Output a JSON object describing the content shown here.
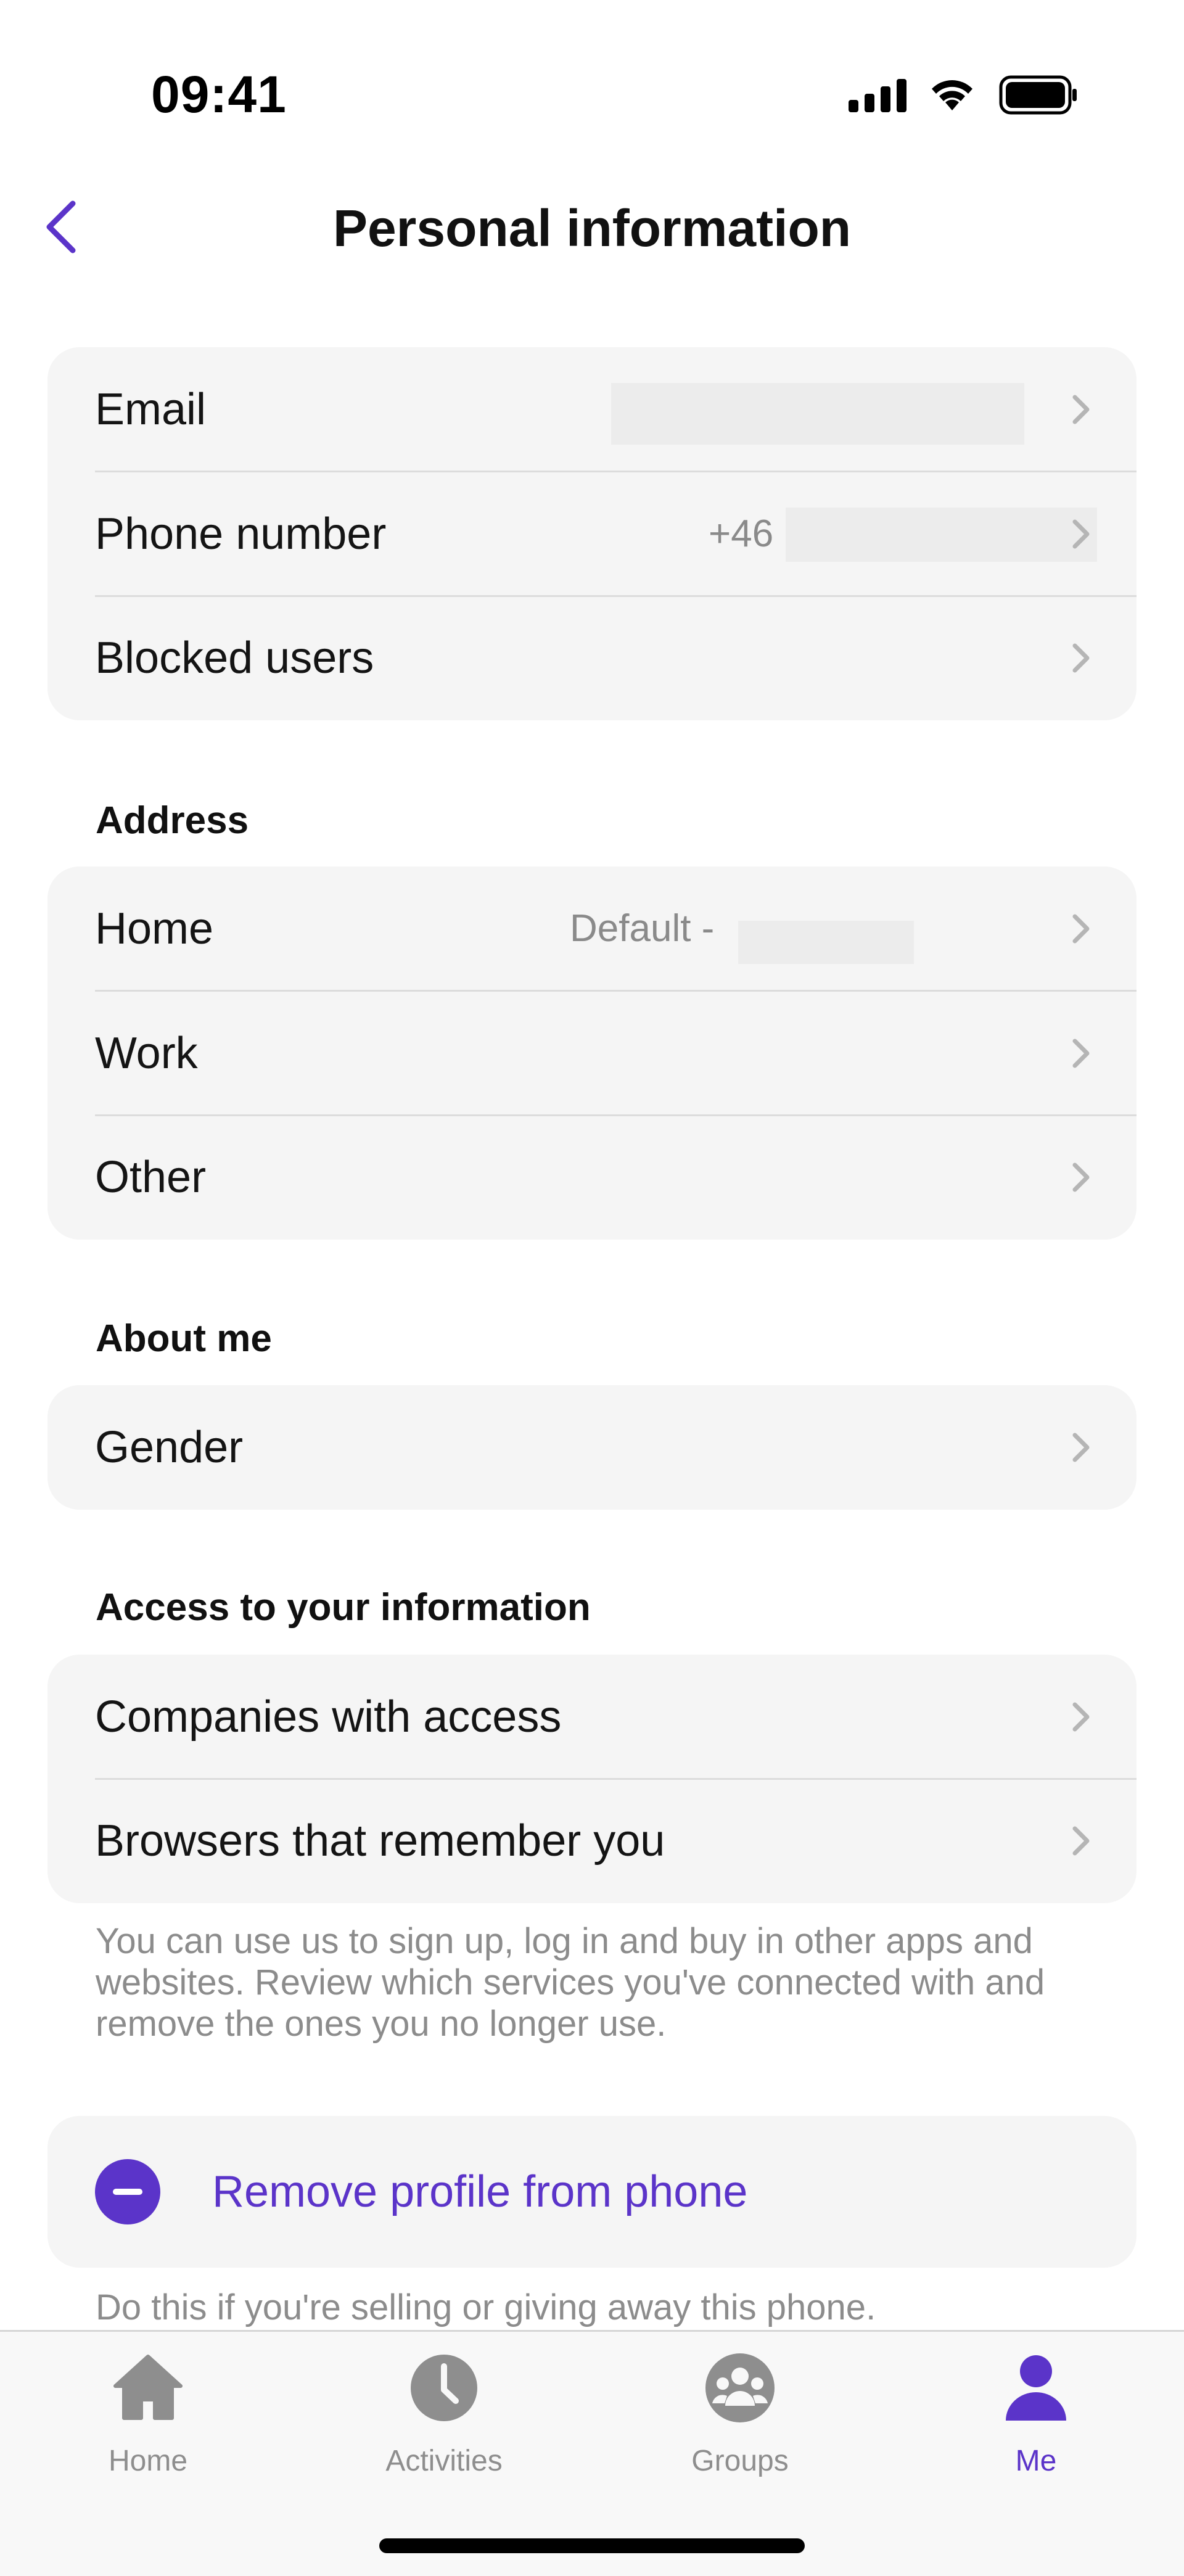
{
  "status_bar": {
    "time": "09:41"
  },
  "header": {
    "title": "Personal information"
  },
  "account": {
    "email_label": "Email",
    "phone_label": "Phone number",
    "phone_value": "+46",
    "blocked_label": "Blocked users"
  },
  "address": {
    "section_title": "Address",
    "home_label": "Home",
    "home_value": "Default -",
    "work_label": "Work",
    "other_label": "Other"
  },
  "about": {
    "section_title": "About me",
    "gender_label": "Gender"
  },
  "access": {
    "section_title": "Access to your information",
    "companies_label": "Companies with access",
    "browsers_label": "Browsers that remember you",
    "footnote": "You can use us to sign up, log in and buy in other apps and websites. Review which services you've connected with and remove the ones you no longer use."
  },
  "remove_profile": {
    "label": "Remove profile from phone",
    "footnote": "Do this if you're selling or giving away this phone."
  },
  "tab_bar": {
    "tabs": [
      {
        "label": "Home",
        "icon": "house-icon",
        "active": false
      },
      {
        "label": "Activities",
        "icon": "clock-icon",
        "active": false
      },
      {
        "label": "Groups",
        "icon": "group-icon",
        "active": false
      },
      {
        "label": "Me",
        "icon": "person-icon",
        "active": true
      }
    ]
  },
  "colors": {
    "accent": "#5b34c9",
    "card_background": "#f5f5f5",
    "secondary_text": "#8c8c8c"
  }
}
